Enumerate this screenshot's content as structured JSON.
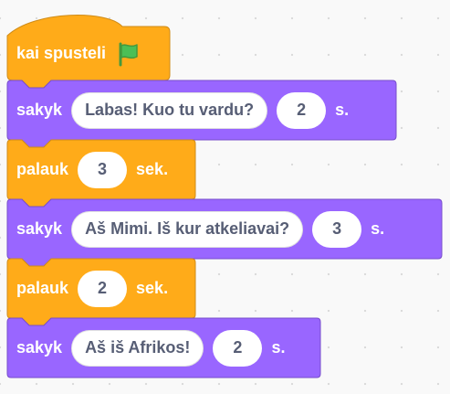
{
  "script": {
    "hat": {
      "label": "kai spusteli",
      "icon": "green-flag-icon",
      "color": "#FFAB19"
    },
    "blocks": [
      {
        "type": "say",
        "color": "#9966FF",
        "label": "sakyk",
        "message": "Labas! Kuo tu vardu?",
        "seconds": "2",
        "unit": "s."
      },
      {
        "type": "wait",
        "color": "#FFAB19",
        "label": "palauk",
        "seconds": "3",
        "unit": "sek."
      },
      {
        "type": "say",
        "color": "#9966FF",
        "label": "sakyk",
        "message": "Aš Mimi. Iš kur atkeliavai?",
        "seconds": "3",
        "unit": "s."
      },
      {
        "type": "wait",
        "color": "#FFAB19",
        "label": "palauk",
        "seconds": "2",
        "unit": "sek."
      },
      {
        "type": "say",
        "color": "#9966FF",
        "label": "sakyk",
        "message": "Aš iš Afrikos!",
        "seconds": "2",
        "unit": "s."
      }
    ]
  }
}
